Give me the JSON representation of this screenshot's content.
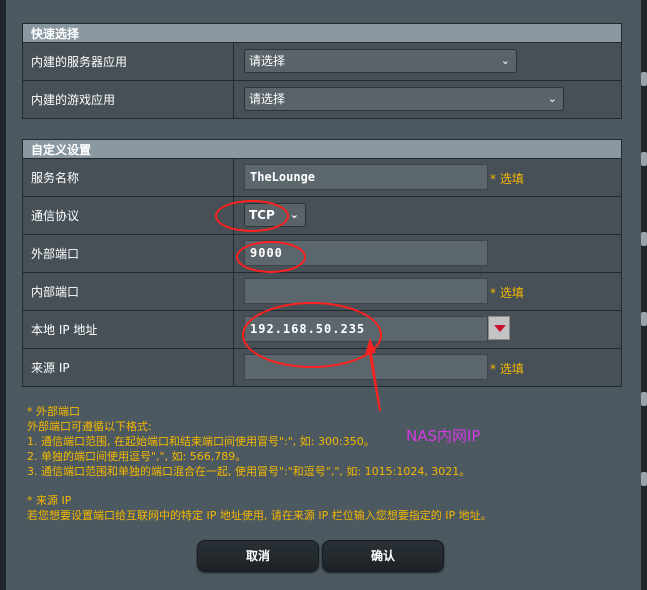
{
  "quick_select": {
    "header": "快速选择",
    "rows": [
      {
        "label": "内建的服务器应用",
        "value": "请选择"
      },
      {
        "label": "内建的游戏应用",
        "value": "请选择"
      }
    ]
  },
  "custom": {
    "header": "自定义设置",
    "service_name": {
      "label": "服务名称",
      "value": "TheLounge",
      "hint": "* 选填"
    },
    "protocol": {
      "label": "通信协议",
      "value": "TCP"
    },
    "external_port": {
      "label": "外部端口",
      "value": "9000"
    },
    "internal_port": {
      "label": "内部端口",
      "value": "",
      "hint": "* 选填"
    },
    "local_ip": {
      "label": "本地 IP 地址",
      "value": "192.168.50.235"
    },
    "source_ip": {
      "label": "来源 IP",
      "value": "",
      "hint": "* 选填"
    }
  },
  "notes": {
    "ext_title": "* 外部端口",
    "ext_intro": "外部端口可遵循以下格式:",
    "ext_1": "1. 通信端口范围, 在起始端口和结束端口间使用冒号\":\", 如: 300:350。",
    "ext_2": "2. 单独的端口间使用逗号\",\", 如: 566,789。",
    "ext_3": "3. 通信端口范围和单独的端口混合在一起, 使用冒号\":\"和逗号\",\", 如: 1015:1024, 3021。",
    "src_title": "* 来源 IP",
    "src_desc": "若您想要设置端口给互联网中的特定 IP 地址使用, 请在来源 IP 栏位输入您想要指定的 IP 地址。"
  },
  "annotation": "NAS内网IP",
  "buttons": {
    "cancel": "取消",
    "confirm": "确认"
  },
  "colors": {
    "annotation": "#ff2020",
    "annotation_text": "#d23ce0",
    "hint": "#f5b800"
  }
}
